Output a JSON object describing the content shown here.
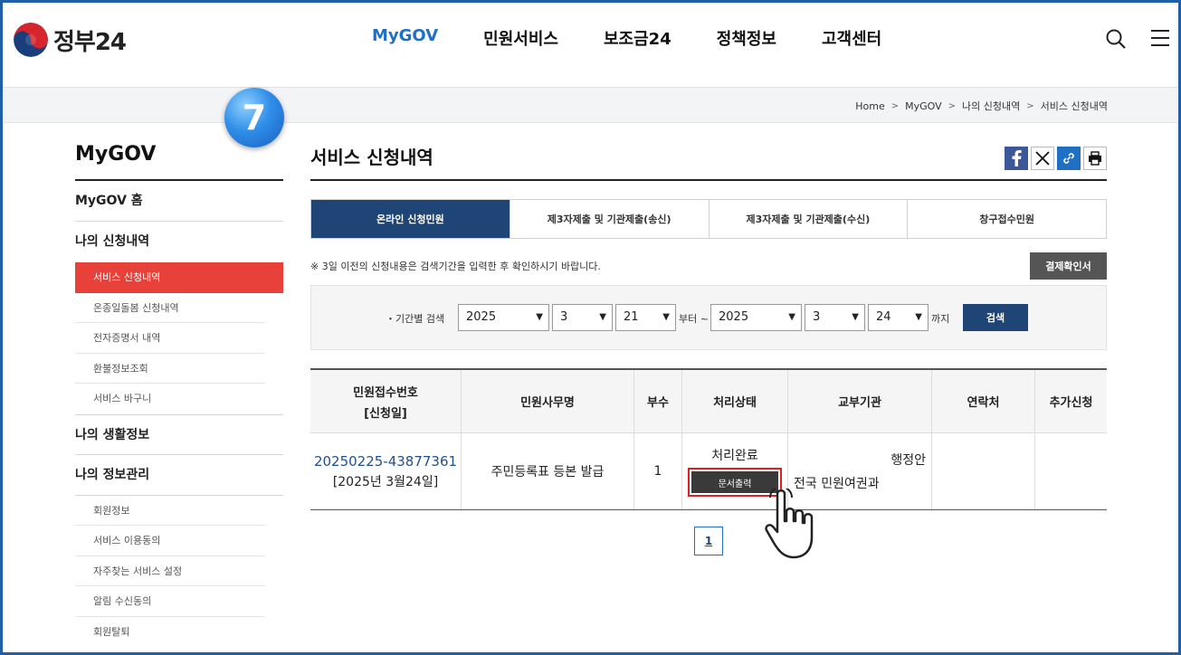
{
  "header": {
    "logo_text": "정부24",
    "nav": [
      "MyGOV",
      "민원서비스",
      "보조금24",
      "정책정보",
      "고객센터"
    ]
  },
  "breadcrumb": [
    "Home",
    "MyGOV",
    "나의 신청내역",
    "서비스 신청내역"
  ],
  "step_badge": "7",
  "sidebar": {
    "title": "MyGOV",
    "home": "MyGOV 홈",
    "section1": "나의 신청내역",
    "section1_items": [
      "서비스 신청내역",
      "온종일돌봄 신청내역",
      "전자증명서 내역",
      "환불정보조회",
      "서비스 바구니"
    ],
    "section2": "나의 생활정보",
    "section3": "나의 정보관리",
    "section3_items": [
      "회원정보",
      "서비스 이용동의",
      "자주찾는 서비스 설정",
      "알림 수신동의",
      "회원탈퇴"
    ]
  },
  "main": {
    "title": "서비스 신청내역",
    "tabs": [
      "온라인 신청민원",
      "제3자제출 및 기관제출(송신)",
      "제3자제출 및 기관제출(수신)",
      "창구접수민원"
    ],
    "notice": "※ 3일 이전의 신청내용은 검색기간을 입력한 후 확인하시기 바랍니다.",
    "confirm_button": "결제확인서",
    "filter": {
      "label": "・기간별 검색",
      "from_year": "2025",
      "from_month": "3",
      "from_day": "21",
      "from_suffix": "부터 ~",
      "to_year": "2025",
      "to_month": "3",
      "to_day": "24",
      "to_suffix": "까지",
      "search_button": "검색"
    },
    "table": {
      "headers": [
        "민원접수번호",
        "[신청일]",
        "민원사무명",
        "부수",
        "처리상태",
        "교부기관",
        "연락처",
        "추가신청"
      ],
      "row": {
        "receipt_no": "20250225-43877361",
        "date": "[2025년 3월24일]",
        "service": "주민등록표 등본 발급",
        "copies": "1",
        "status": "처리완료",
        "print_button": "문서출력",
        "agency_line1": "행정안",
        "agency_line2": "전국 민원여권과",
        "contact": "",
        "extra": ""
      }
    },
    "page": "1"
  }
}
